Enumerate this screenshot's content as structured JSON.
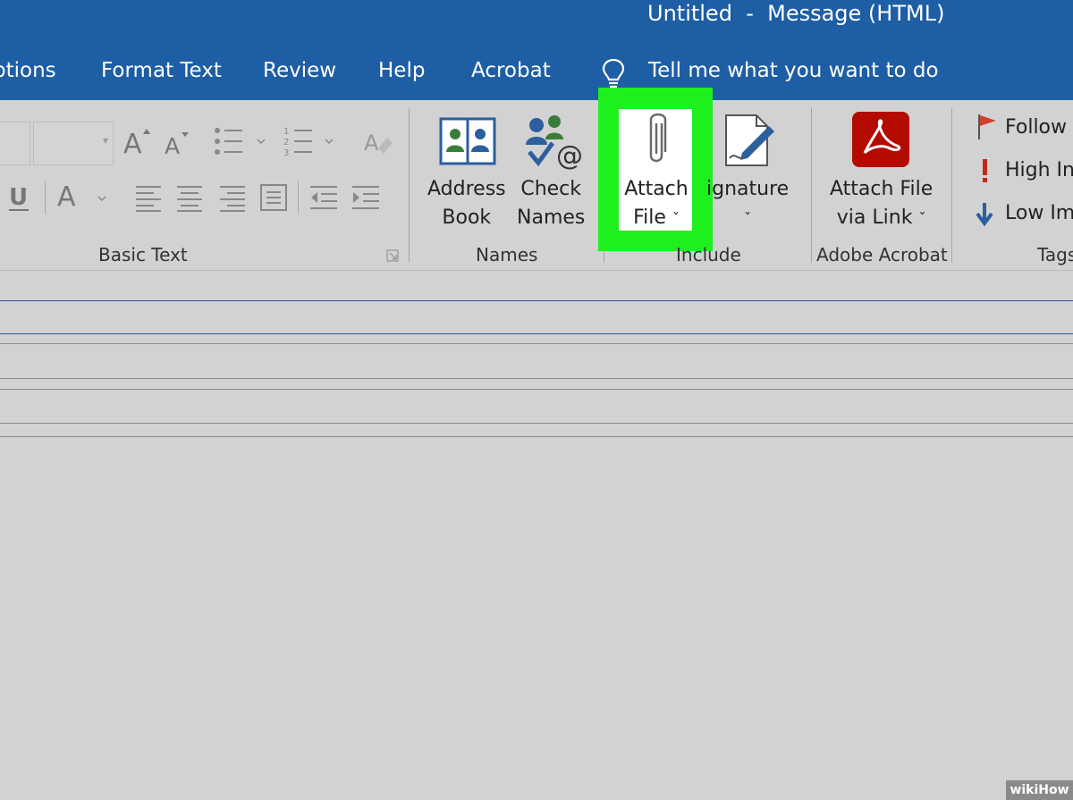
{
  "window": {
    "title": "Untitled  -  Message (HTML)"
  },
  "tabs": [
    "ptions",
    "Format Text",
    "Review",
    "Help",
    "Acrobat"
  ],
  "tell_me": "Tell me what you want to do",
  "groups": {
    "basic_text": {
      "label": "Basic Text"
    },
    "names": {
      "label": "Names",
      "address_book": [
        "Address",
        "Book"
      ],
      "check_names": [
        "Check",
        "Names"
      ]
    },
    "include": {
      "label": "Include",
      "attach_file": [
        "Attach",
        "File"
      ],
      "signature": "ignature"
    },
    "adobe": {
      "label": "Adobe Acrobat",
      "attach_link": [
        "Attach File",
        "via Link"
      ]
    },
    "tags": {
      "label": "Tags",
      "follow_up": "Follow",
      "high_importance": "High In",
      "low_importance": "Low Im"
    }
  },
  "watermark": "wikiHow",
  "colors": {
    "titlebar": "#1e5ea4",
    "highlight": "#1ef01e",
    "ribbon": "#d2d2d2",
    "acrobat_red": "#b30b00"
  },
  "icons": [
    "bulb-icon",
    "font-grow-icon",
    "font-shrink-icon",
    "bullets-icon",
    "numbering-icon",
    "clear-format-icon",
    "underline-icon",
    "font-color-icon",
    "align-left-icon",
    "align-center-icon",
    "align-right-icon",
    "text-direction-icon",
    "decrease-indent-icon",
    "increase-indent-icon",
    "address-book-icon",
    "check-names-icon",
    "paperclip-icon",
    "signature-icon",
    "acrobat-icon",
    "flag-icon",
    "exclamation-icon",
    "down-arrow-icon"
  ]
}
